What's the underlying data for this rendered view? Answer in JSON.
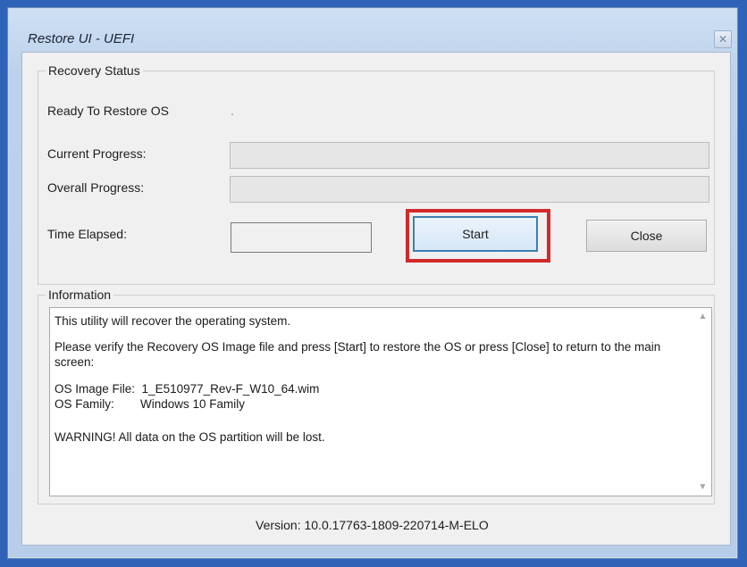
{
  "window": {
    "title": "Restore UI - UEFI",
    "close_glyph": "✕"
  },
  "status_group": {
    "legend": "Recovery Status",
    "status_text": "Ready To Restore OS",
    "status_dot": ".",
    "current_progress_label": "Current Progress:",
    "current_progress_value": 0,
    "overall_progress_label": "Overall Progress:",
    "overall_progress_value": 0,
    "time_elapsed_label": "Time Elapsed:",
    "time_elapsed_value": ""
  },
  "buttons": {
    "start": "Start",
    "close": "Close"
  },
  "info_group": {
    "legend": "Information",
    "line1": "This utility will recover the operating system.",
    "line2": "Please verify the Recovery OS Image file and press [Start] to restore the OS or press [Close] to return to the main screen:",
    "os_image_label": "OS Image File:",
    "os_image_value": "1_E510977_Rev-F_W10_64.wim",
    "os_family_label": "OS Family:",
    "os_family_value": "Windows 10 Family",
    "warning": "WARNING!  All data on the OS partition will be lost.",
    "scroll_up": "▲",
    "scroll_down": "▼"
  },
  "footer": {
    "version": "Version: 10.0.17763-1809-220714-M-ELO"
  },
  "colors": {
    "highlight": "#d22a2a",
    "default_button_border": "#3c7fb1",
    "window_frame": "#bcd2ec"
  }
}
